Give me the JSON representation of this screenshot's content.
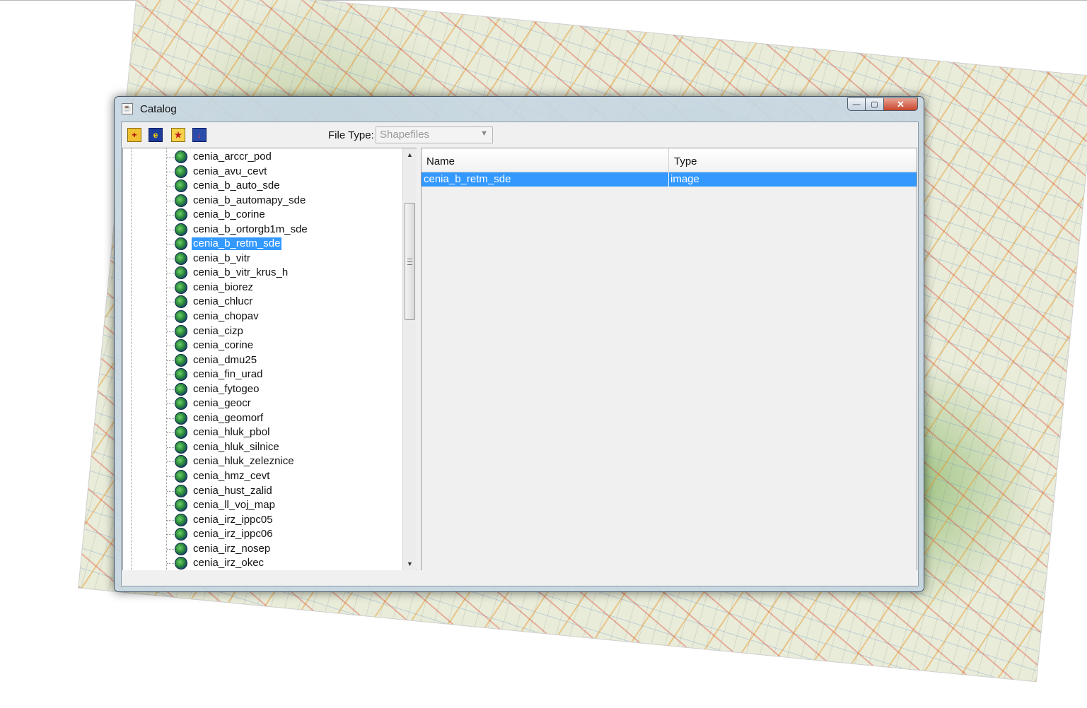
{
  "window": {
    "title": "Catalog",
    "title_icon": "java-cup-icon",
    "controls": {
      "minimize": "—",
      "maximize": "▢",
      "close": "✕"
    }
  },
  "toolbar": {
    "icons": [
      "add-layer-icon",
      "catalog-icon",
      "new-folder-icon",
      "save-icon"
    ],
    "file_type_label": "File Type:",
    "file_type_value": "Shapefiles"
  },
  "tree": {
    "selected_index": 6,
    "items": [
      "cenia_arccr_pod",
      "cenia_avu_cevt",
      "cenia_b_auto_sde",
      "cenia_b_automapy_sde",
      "cenia_b_corine",
      "cenia_b_ortorgb1m_sde",
      "cenia_b_retm_sde",
      "cenia_b_vitr",
      "cenia_b_vitr_krus_h",
      "cenia_biorez",
      "cenia_chlucr",
      "cenia_chopav",
      "cenia_cizp",
      "cenia_corine",
      "cenia_dmu25",
      "cenia_fin_urad",
      "cenia_fytogeo",
      "cenia_geocr",
      "cenia_geomorf",
      "cenia_hluk_pbol",
      "cenia_hluk_silnice",
      "cenia_hluk_zeleznice",
      "cenia_hmz_cevt",
      "cenia_hust_zalid",
      "cenia_ll_voj_map",
      "cenia_irz_ippc05",
      "cenia_irz_ippc06",
      "cenia_irz_nosep",
      "cenia_irz_okec"
    ]
  },
  "table": {
    "columns": [
      "Name",
      "Type"
    ],
    "rows": [
      {
        "name": "cenia_b_retm_sde",
        "type": "image"
      }
    ]
  },
  "colors": {
    "selection": "#3399ff",
    "close_button": "#c9452c"
  }
}
